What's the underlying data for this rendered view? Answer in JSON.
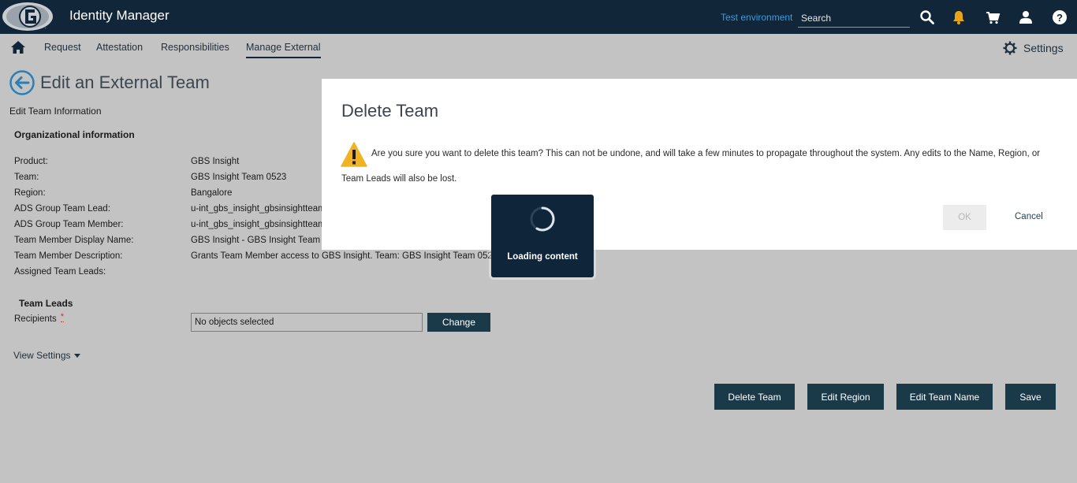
{
  "header": {
    "app_title": "Identity Manager",
    "environment": "Test environment",
    "search_placeholder": "Search",
    "icons": [
      "search-icon",
      "bell-icon",
      "cart-icon",
      "user-icon",
      "help-icon"
    ],
    "bell_color": "#e8a317"
  },
  "nav": {
    "items": [
      "Request",
      "Attestation",
      "Responsibilities",
      "Manage External"
    ],
    "active": "Manage External",
    "settings_label": "Settings"
  },
  "page": {
    "title": "Edit an External Team",
    "subtitle": "Edit Team Information",
    "section_org": "Organizational information",
    "fields": [
      {
        "label": "Product:",
        "value": "GBS Insight"
      },
      {
        "label": "Team:",
        "value": "GBS Insight Team 0523"
      },
      {
        "label": "Region:",
        "value": "Bangalore"
      },
      {
        "label": "ADS Group Team Lead:",
        "value": "u-int_gbs_insight_gbsinsightteam"
      },
      {
        "label": "ADS Group Team Member:",
        "value": "u-int_gbs_insight_gbsinsightteam"
      },
      {
        "label": "Team Member Display Name:",
        "value": "GBS Insight - GBS Insight Team 05"
      },
      {
        "label": "Team Member Description:",
        "value": "Grants Team Member access to GBS Insight. Team: GBS Insight Team 0523"
      },
      {
        "label": "Assigned Team Leads:",
        "value": ""
      }
    ],
    "section_leads": "Team Leads",
    "recipients_label": "Recipients",
    "required_mark": "*",
    "recipients_value": "No objects selected",
    "change_button": "Change",
    "view_settings": "View Settings",
    "buttons": {
      "delete_team": "Delete Team",
      "edit_region": "Edit Region",
      "edit_team_name": "Edit Team Name",
      "save": "Save"
    }
  },
  "modal": {
    "title": "Delete Team",
    "message": "Are you sure you want to delete this team? This can not be undone, and will take a few minutes to propagate throughout the system. Any edits to the Name, Region, or Team Leads will also be lost.",
    "ok_label": "OK",
    "cancel_label": "Cancel",
    "warning_color": "#f0b323"
  },
  "loading": {
    "text": "Loading content"
  }
}
